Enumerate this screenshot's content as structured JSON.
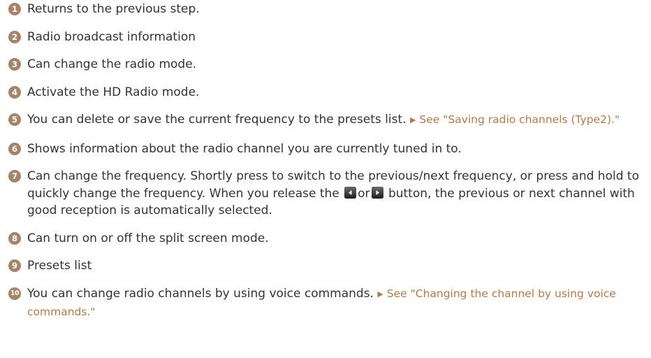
{
  "items": [
    {
      "num": "1",
      "text": "Returns to the previous step."
    },
    {
      "num": "2",
      "text": "Radio broadcast information"
    },
    {
      "num": "3",
      "text": "Can change the radio mode."
    },
    {
      "num": "4",
      "text": "Activate the HD Radio mode."
    },
    {
      "num": "5",
      "text": "You can delete or save the current frequency to the presets list.",
      "see": "See \"Saving radio channels (Type2).\""
    },
    {
      "num": "6",
      "text": "Shows information about the radio channel you are currently tuned in to."
    },
    {
      "num": "7",
      "text_before": "Can change the frequency. Shortly press to switch to the previous/next frequency, or press and hold to quickly change the frequency. When you release the",
      "text_or": "or",
      "text_after": "button, the previous or next channel with good reception is automatically selected."
    },
    {
      "num": "8",
      "text": "Can turn on or off the split screen mode."
    },
    {
      "num": "9",
      "text": "Presets list"
    },
    {
      "num": "10",
      "text": "You can change radio channels by using voice commands.",
      "see": "See \"Changing the channel by using voice commands.\""
    }
  ],
  "xref_marker": "▶",
  "icons": {
    "prev": "seek-previous-icon",
    "next": "seek-next-icon"
  },
  "colors": {
    "badge": "#a5856a",
    "link": "#b17a4b",
    "text": "#333333"
  }
}
